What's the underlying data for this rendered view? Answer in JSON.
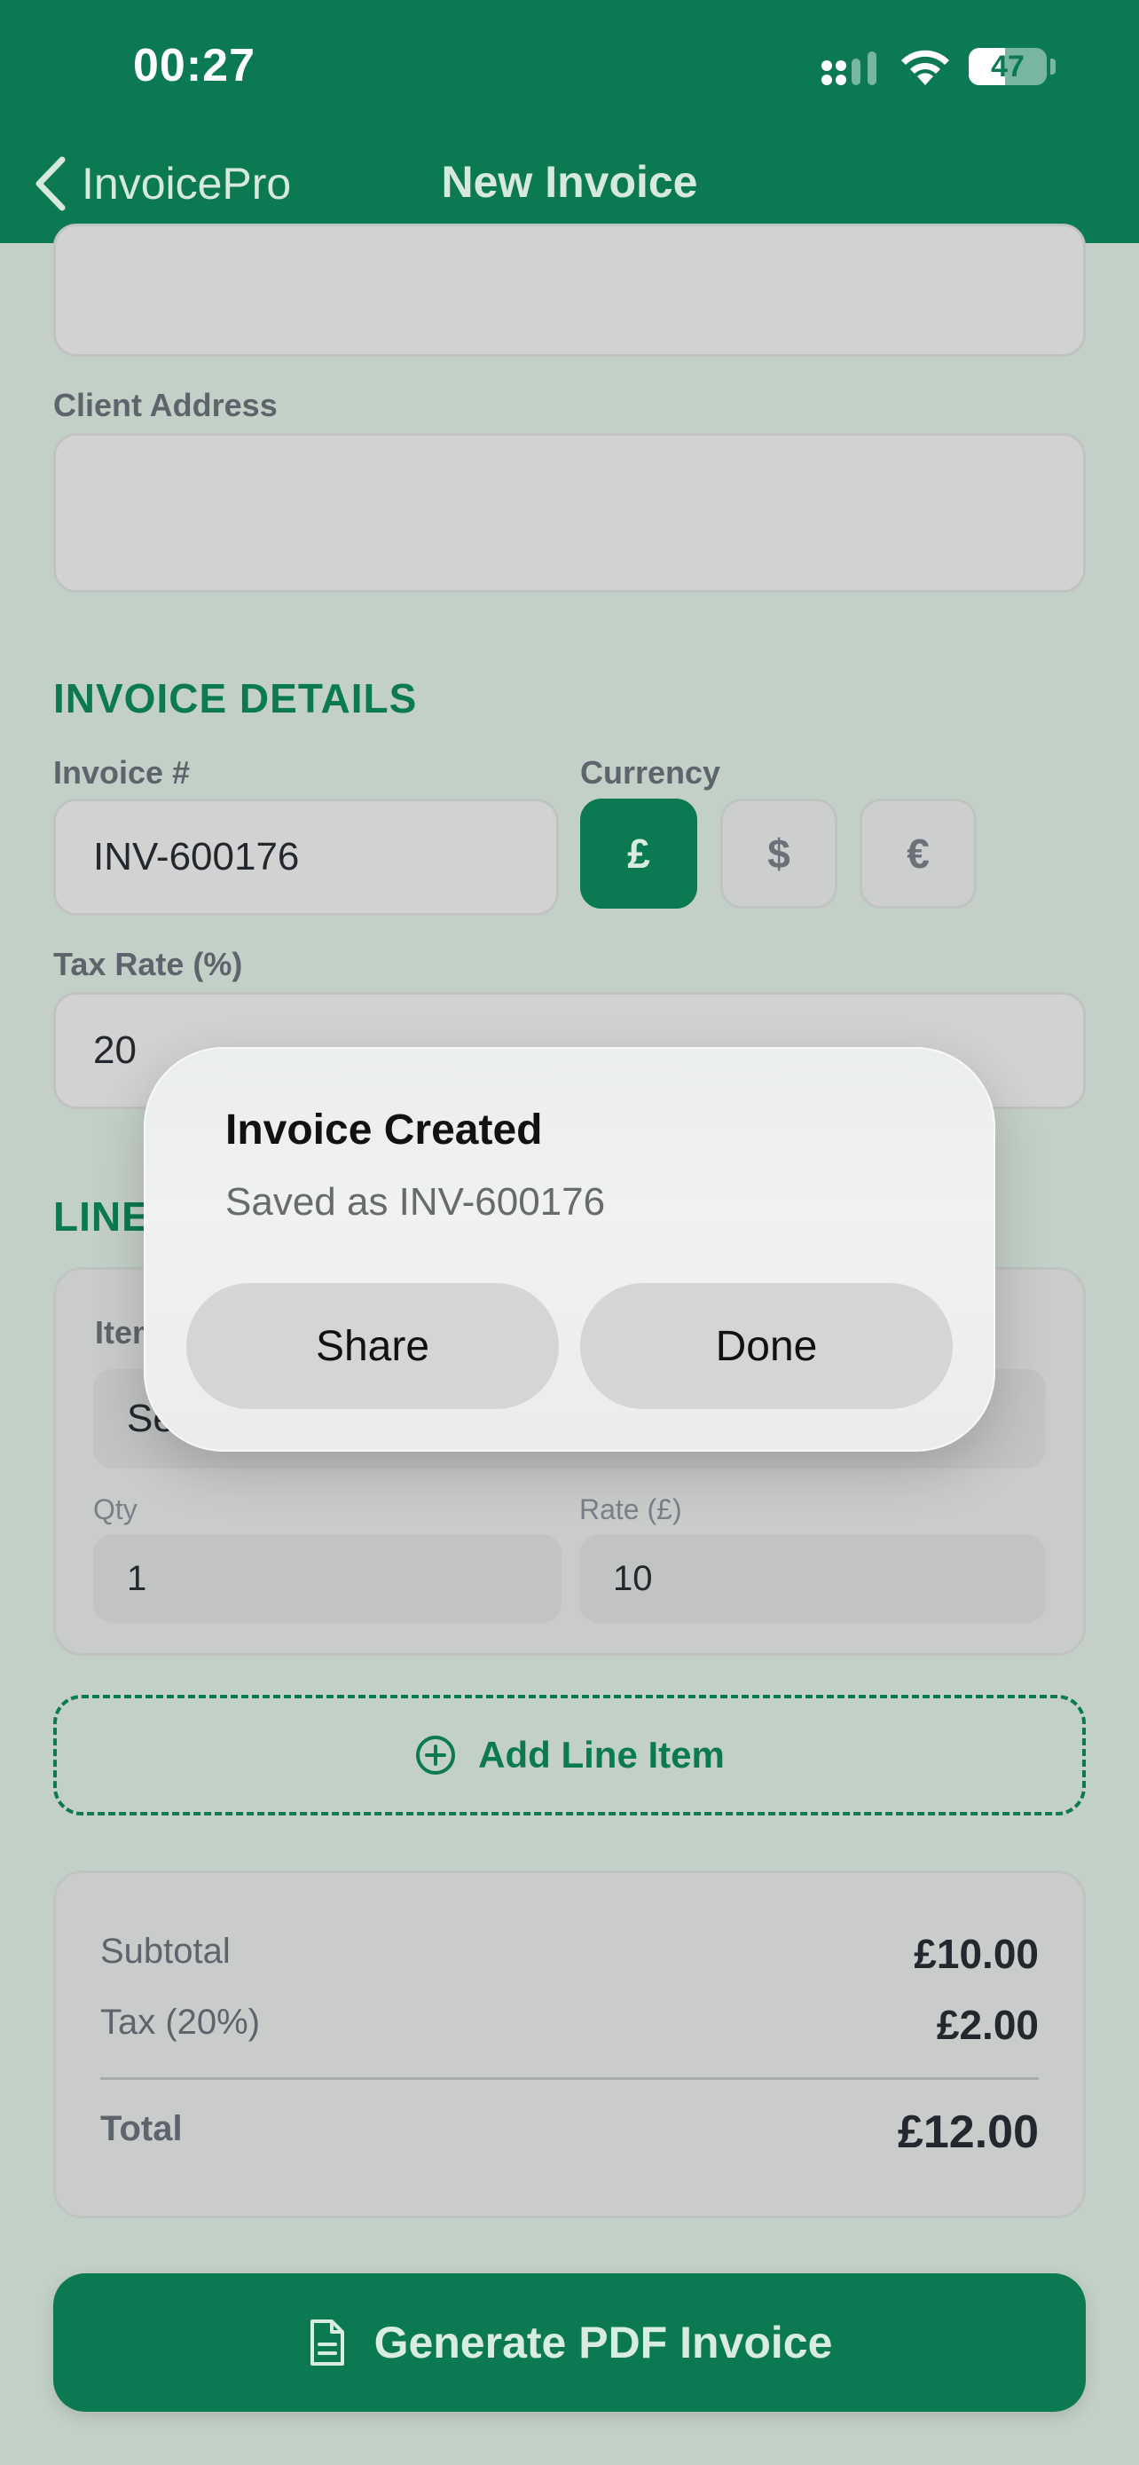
{
  "status_bar": {
    "time": "00:27",
    "battery": "47",
    "battery_level_percent": 47
  },
  "nav": {
    "back_label": "InvoicePro",
    "title": "New Invoice"
  },
  "client": {
    "name_value": "",
    "address_label": "Client Address",
    "address_value": ""
  },
  "invoice_details": {
    "section_title": "INVOICE DETAILS",
    "invoice_number_label": "Invoice #",
    "invoice_number_value": "INV-600176",
    "currency_label": "Currency",
    "currencies": [
      "£",
      "$",
      "€"
    ],
    "selected_currency": "£",
    "tax_rate_label": "Tax Rate (%)",
    "tax_rate_value": "20"
  },
  "line_items": {
    "section_title_visible": "LINE",
    "item_label_visible": "Item",
    "item_value_visible": "Se",
    "qty_label": "Qty",
    "qty_value": "1",
    "rate_label": "Rate (£)",
    "rate_value": "10",
    "add_label": "Add Line Item"
  },
  "totals": {
    "subtotal_label": "Subtotal",
    "subtotal_value": "£10.00",
    "tax_label": "Tax (20%)",
    "tax_value": "£2.00",
    "total_label": "Total",
    "total_value": "£12.00"
  },
  "generate_label": "Generate PDF Invoice",
  "alert": {
    "title": "Invoice Created",
    "message": "Saved as INV-600176",
    "share_label": "Share",
    "done_label": "Done"
  },
  "colors": {
    "brand": "#0b7a52",
    "background": "#c3d0c7"
  }
}
